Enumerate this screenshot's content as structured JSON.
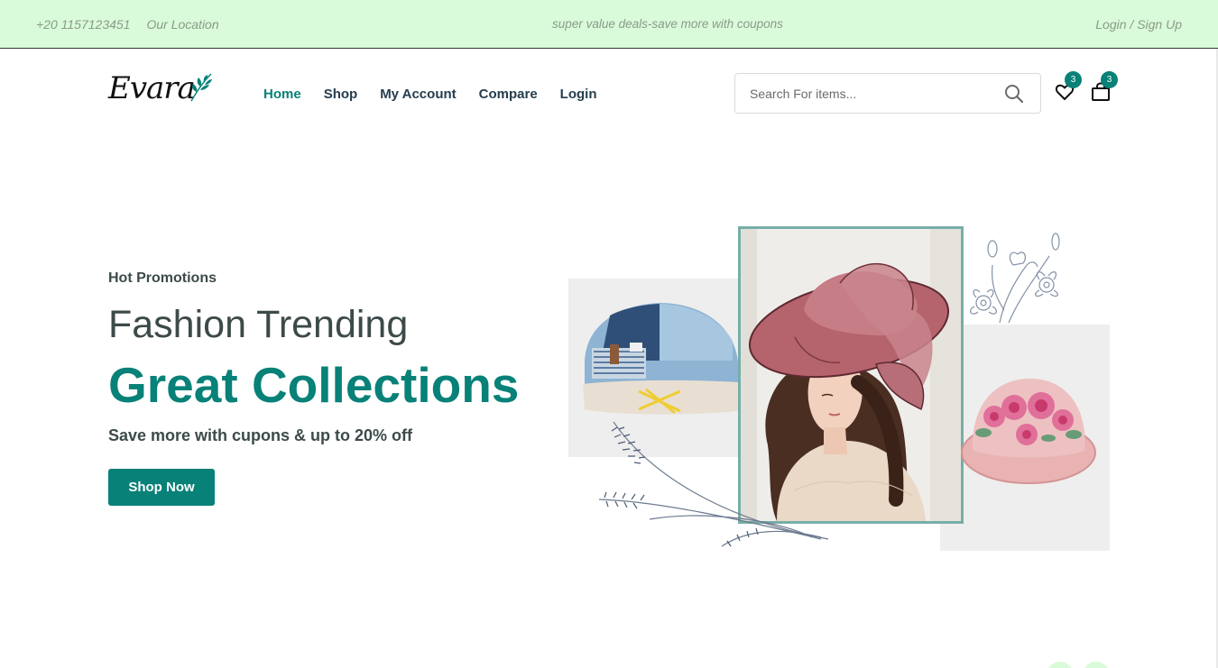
{
  "topbar": {
    "phone": "+20 1157123451",
    "location": "Our Location",
    "promo": "super value deals-save more with coupons",
    "auth": "Login / Sign Up"
  },
  "header": {
    "logo_text": "Evara",
    "nav": [
      "Home",
      "Shop",
      "My Account",
      "Compare",
      "Login"
    ],
    "active_nav": "Home",
    "search_placeholder": "Search For items...",
    "wishlist_count": "3",
    "cart_count": "3"
  },
  "hero": {
    "tag": "Hot Promotions",
    "title": "Fashion Trending",
    "highlight": "Great Collections",
    "subtitle": "Save more with cupons & up to 20% off",
    "cta": "Shop Now"
  },
  "colors": {
    "accent": "#088178",
    "topbar_bg": "#d9fbd9",
    "heading": "#3d4a4a",
    "photo_border": "#76aea8"
  },
  "icons": [
    "leaf-icon",
    "search-icon",
    "heart-icon",
    "bag-icon"
  ]
}
